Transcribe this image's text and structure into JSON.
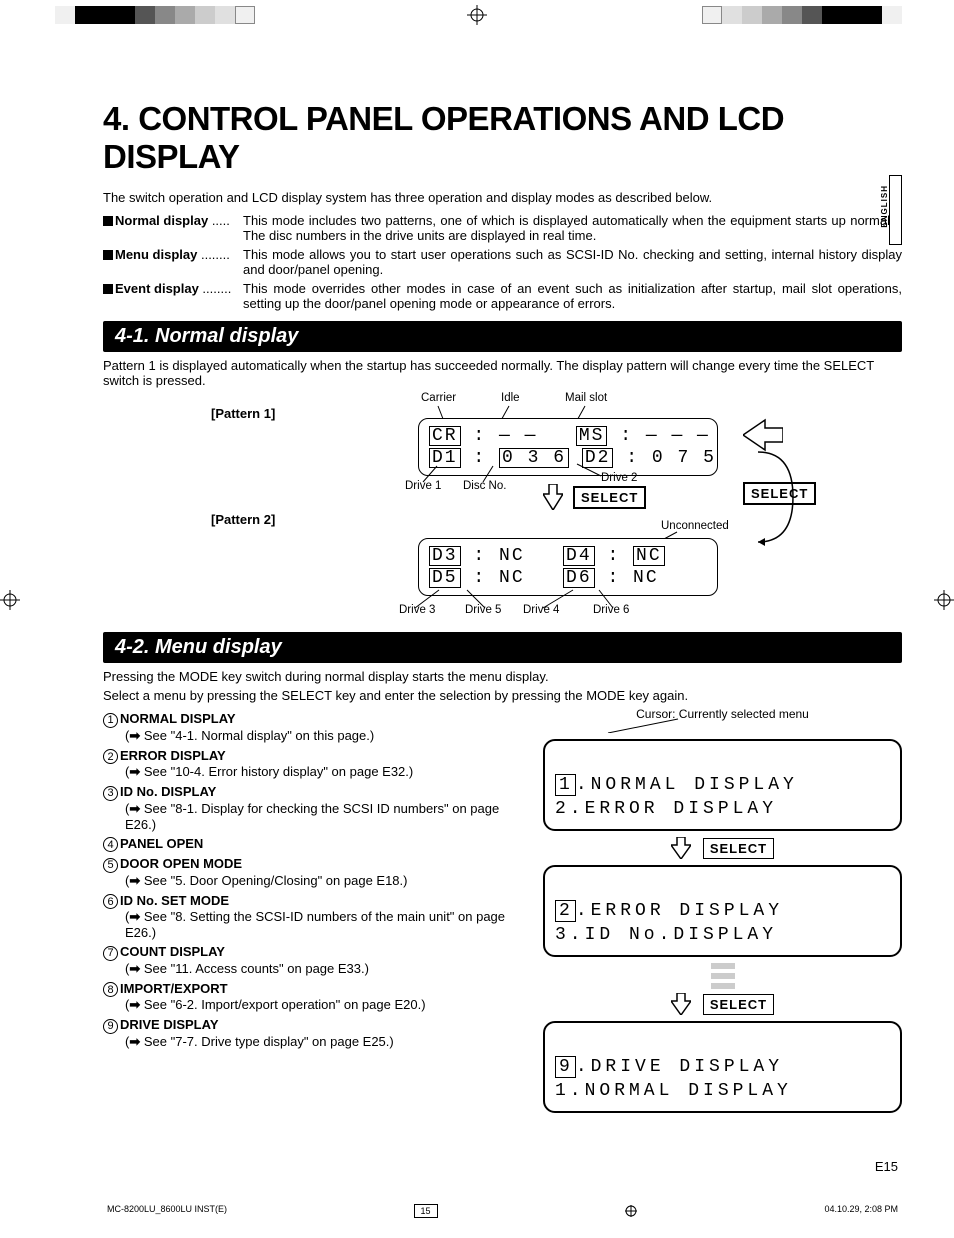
{
  "lang_tab": "ENGLISH",
  "title": "4. CONTROL PANEL OPERATIONS AND LCD DISPLAY",
  "intro": "The switch operation and LCD display system has three operation and display modes as described below.",
  "modes": [
    {
      "name": "Normal display",
      "dots": " .....",
      "desc": "This mode includes two patterns, one of which is displayed automatically when the equipment starts up normally. The disc numbers in the drive units are displayed in real time."
    },
    {
      "name": "Menu display",
      "dots": " ........",
      "desc": "This mode allows you to start user operations such as SCSI-ID No. checking and setting, internal history display and door/panel opening."
    },
    {
      "name": "Event display",
      "dots": " ........",
      "desc": "This mode overrides other modes in case of an event such as initialization after startup, mail slot operations, setting up the door/panel opening mode or appearance of errors."
    }
  ],
  "sec1": {
    "heading": "4-1. Normal display",
    "text": "Pattern 1 is displayed automatically when the startup has succeeded normally. The display pattern will change every time the SELECT switch is pressed.",
    "pattern1_label": "[Pattern 1]",
    "pattern2_label": "[Pattern 2]",
    "callouts": {
      "carrier": "Carrier",
      "idle": "Idle",
      "mailslot": "Mail slot",
      "drive1": "Drive 1",
      "discno": "Disc No.",
      "drive2": "Drive 2",
      "drive3": "Drive 3",
      "drive4": "Drive 4",
      "drive5": "Drive 5",
      "drive6": "Drive 6",
      "unconnected": "Unconnected"
    },
    "lcd1": {
      "cr": "CR",
      "d1": "D1",
      "d1v": "0 3 6",
      "ms": "MS",
      "d2": "D2",
      "d2v": "0 7 5",
      "idle": "— —",
      "msv": "— — —"
    },
    "lcd2": {
      "d3": "D3",
      "d3v": "NC",
      "d4": "D4",
      "d4v": "NC",
      "d5": "D5",
      "d5v": "NC",
      "d6": "D6",
      "d6v": "NC"
    },
    "select": "SELECT"
  },
  "sec2": {
    "heading": "4-2. Menu display",
    "p1": "Pressing the MODE key switch during normal display starts the menu display.",
    "p2": "Select a menu by pressing the SELECT key and enter the selection by pressing the MODE key again.",
    "cursor_note": "Cursor: Currently selected menu",
    "menus": [
      {
        "n": "1",
        "title": "NORMAL DISPLAY",
        "ref": "See \"4-1. Normal display\" on this page.)"
      },
      {
        "n": "2",
        "title": "ERROR DISPLAY",
        "ref": "See \"10-4. Error history display\" on page E32.)"
      },
      {
        "n": "3",
        "title": "ID No. DISPLAY",
        "ref": "See \"8-1. Display for checking the SCSI ID numbers\" on page E26.)"
      },
      {
        "n": "4",
        "title": "PANEL OPEN",
        "ref": ""
      },
      {
        "n": "5",
        "title": "DOOR OPEN MODE",
        "ref": "See \"5. Door Opening/Closing\" on page E18.)"
      },
      {
        "n": "6",
        "title": "ID No. SET MODE",
        "ref": "See \"8. Setting the SCSI-ID numbers of the main unit\" on page E26.)"
      },
      {
        "n": "7",
        "title": "COUNT DISPLAY",
        "ref": "See \"11. Access counts\" on page E33.)"
      },
      {
        "n": "8",
        "title": "IMPORT/EXPORT",
        "ref": "See \"6-2. Import/export operation\" on page E20.)"
      },
      {
        "n": "9",
        "title": "DRIVE DISPLAY",
        "ref": "See \"7-7. Drive type display\" on page E25.)"
      }
    ],
    "lcd_menus": {
      "a_l1_num": "1",
      "a_l1": ".NORMAL DISPLAY",
      "a_l2": "2.ERROR DISPLAY",
      "b_l1_num": "2",
      "b_l1": ".ERROR DISPLAY",
      "b_l2": "3.ID No.DISPLAY",
      "c_l1_num": "9",
      "c_l1": ".DRIVE DISPLAY",
      "c_l2": "1.NORMAL DISPLAY"
    },
    "select": "SELECT"
  },
  "page_no": "E15",
  "footer": {
    "doc": "MC-8200LU_8600LU INST(E)",
    "page": "15",
    "timestamp": "04.10.29, 2:08 PM"
  }
}
